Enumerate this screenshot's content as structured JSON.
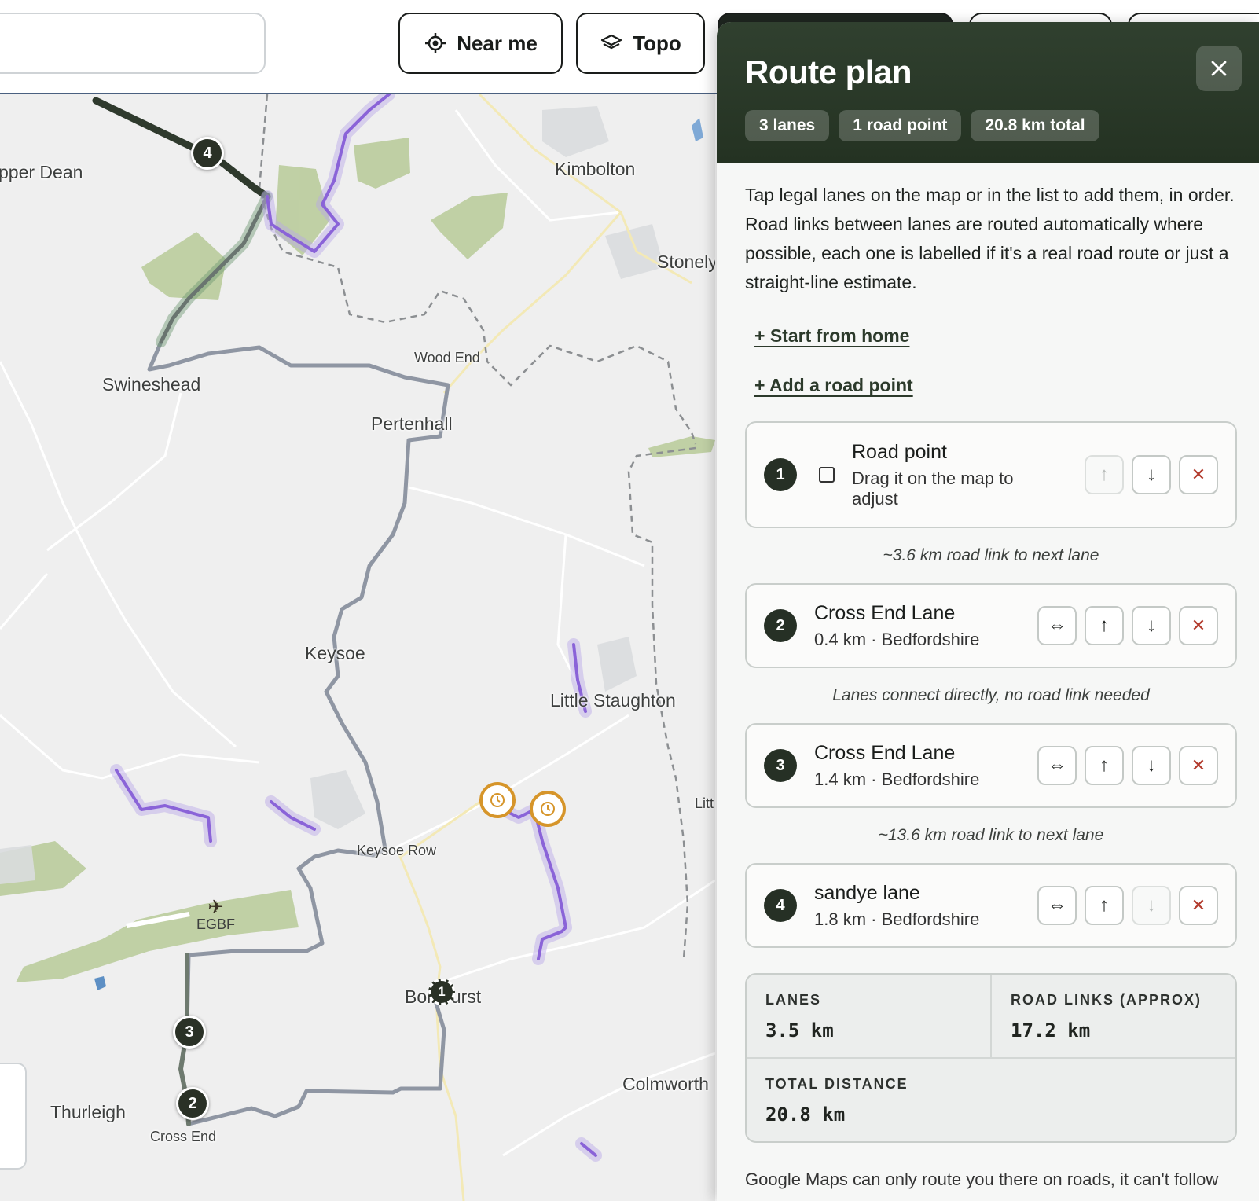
{
  "toolbar": {
    "near_me_label": "Near me",
    "topo_label": "Topo"
  },
  "map": {
    "places": {
      "upper_dean": "pper Dean",
      "kimbolton": "Kimbolton",
      "stonely": "Stonely",
      "wood_end": "Wood End",
      "swineshead": "Swineshead",
      "pertenhall": "Pertenhall",
      "keysoe": "Keysoe",
      "little_staughton": "Little Staughton",
      "litt": "Litt",
      "keysoe_row": "Keysoe Row",
      "egbf": "EGBF",
      "bolnhurst": "Bolnhurst",
      "colmworth": "Colmworth",
      "thurleigh": "Thurleigh",
      "cross_end": "Cross End"
    },
    "markers": [
      "1",
      "2",
      "3",
      "4"
    ],
    "colors": {
      "route_road": "#8f96a3",
      "lane_selected": "#2f3a2d",
      "lane_available": "#8a63d8",
      "woodland": "#b8cc9a",
      "poi": "#d6952a"
    }
  },
  "panel": {
    "title": "Route plan",
    "chips": [
      "3 lanes",
      "1 road point",
      "20.8 km total"
    ],
    "intro": "Tap legal lanes on the map or in the list to add them, in order. Road links between lanes are routed automatically where possible, each one is labelled if it's a real road route or just a straight-line estimate.",
    "start_from_home": "+ Start from home",
    "add_road_point": "+ Add a road point",
    "stops": [
      {
        "num": "1",
        "name": "Road point",
        "sub": "Drag it on the map to adjust"
      },
      {
        "num": "2",
        "name": "Cross End Lane",
        "sub": "0.4 km · Bedfordshire"
      },
      {
        "num": "3",
        "name": "Cross End Lane",
        "sub": "1.4 km · Bedfordshire"
      },
      {
        "num": "4",
        "name": "sandye lane",
        "sub": "1.8 km · Bedfordshire"
      }
    ],
    "links": [
      "~3.6 km road link to next lane",
      "Lanes connect directly, no road link needed",
      "~13.6 km road link to next lane"
    ],
    "stats": {
      "lanes_label": "LANES",
      "lanes_value": "3.5 km",
      "road_links_label": "ROAD LINKS (APPROX)",
      "road_links_value": "17.2 km",
      "total_label": "TOTAL DISTANCE",
      "total_value": "20.8 km"
    },
    "footer": "Google Maps can only route you there on roads, it can't follow"
  }
}
